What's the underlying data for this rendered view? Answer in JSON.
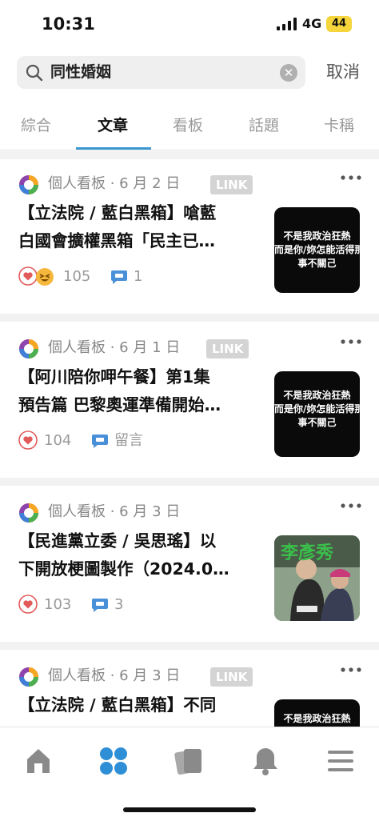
{
  "status_bar": {
    "time": "10:31",
    "network": "4G",
    "battery": "44"
  },
  "search": {
    "query": "同性婚姻",
    "clear_icon": "clear-icon",
    "cancel_label": "取消"
  },
  "tabs": [
    {
      "label": "綜合",
      "active": false
    },
    {
      "label": "文章",
      "active": true
    },
    {
      "label": "看板",
      "active": false
    },
    {
      "label": "話題",
      "active": false
    },
    {
      "label": "卡稱",
      "active": false
    }
  ],
  "posts": [
    {
      "board": "個人看板",
      "date": "6 月 2 日",
      "badge": "LINK",
      "title_line1": "【立法院 / 藍白黑箱】嗆藍",
      "title_line2": "白國會擴權黑箱「民主已…",
      "likes": "105",
      "comments": "1",
      "reactions": [
        "heart-icon",
        "haha-icon"
      ],
      "thumb_lines": [
        "不是我政治狂熱",
        "而是你/妳怎能活得那麼",
        "事不關己"
      ]
    },
    {
      "board": "個人看板",
      "date": "6 月 1 日",
      "badge": "LINK",
      "title_line1": "【阿川陪你呷午餐】第1集",
      "title_line2": "預告篇 巴黎奧運準備開始…",
      "likes": "104",
      "comments": "留言",
      "reactions": [
        "heart-icon"
      ],
      "thumb_lines": [
        "不是我政治狂熱",
        "而是你/妳怎能活得那麼",
        "事不關己"
      ]
    },
    {
      "board": "個人看板",
      "date": "6 月 3 日",
      "badge": "",
      "title_line1": "【民進黨立委 / 吳思瑤】以",
      "title_line2": "下開放梗圖製作（2024.0…",
      "likes": "103",
      "comments": "3",
      "reactions": [
        "heart-icon"
      ],
      "thumb_lines": [
        "李彥秀"
      ]
    },
    {
      "board": "個人看板",
      "date": "6 月 3 日",
      "badge": "LINK",
      "title_line1": "【立法院 / 藍白黑箱】不同",
      "title_line2": "",
      "likes": "",
      "comments": "",
      "reactions": [],
      "thumb_lines": [
        "不是我政治狂熱"
      ]
    }
  ],
  "bottom_nav": [
    "home-icon",
    "grid-icon",
    "cards-icon",
    "bell-icon",
    "menu-icon"
  ],
  "colors": {
    "accent": "#3c97d3",
    "heart": "#e25b5b",
    "muted": "#9a9a9a"
  }
}
